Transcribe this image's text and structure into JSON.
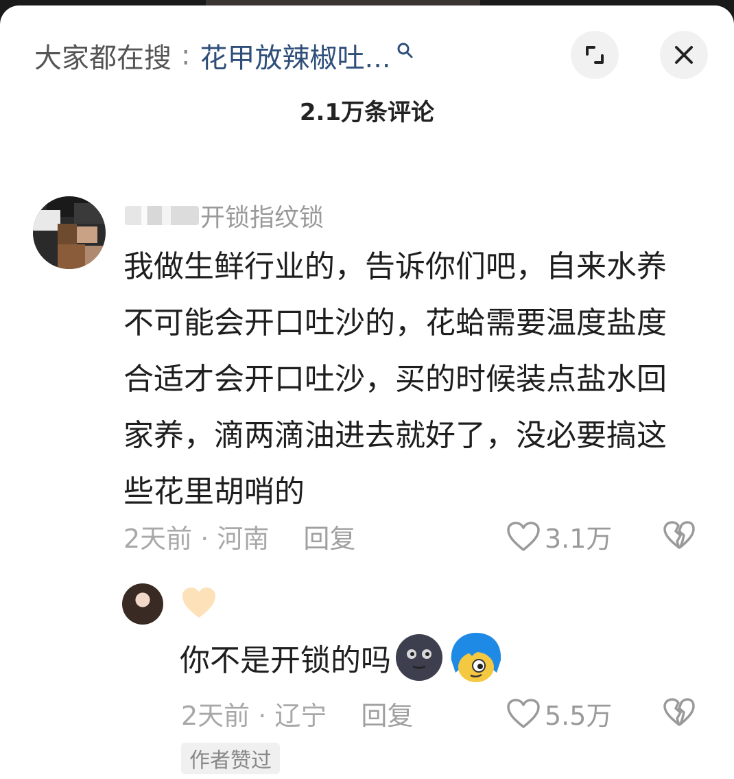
{
  "header": {
    "search_prefix": "大家都在搜",
    "search_colon": ":",
    "search_term": "花甲放辣椒吐...",
    "title": "2.1万条评论"
  },
  "comment": {
    "username": "开锁指纹锁",
    "text": "我做生鲜行业的，告诉你们吧，自来水养不可能会开口吐沙的，花蛤需要温度盐度合适才会开口吐沙，买的时候装点盐水回家养，滴两滴油进去就好了，没必要搞这些花里胡哨的",
    "time_location": "2天前 · 河南",
    "reply_label": "回复",
    "like_count": "3.1万"
  },
  "reply": {
    "text": "你不是开锁的吗",
    "time_location": "2天前 · 辽宁",
    "reply_label": "回复",
    "like_count": "5.5万",
    "author_badge": "作者赞过"
  },
  "icons": {
    "search": "search-icon",
    "expand": "expand-icon",
    "close": "close-icon",
    "like": "heart-outline-icon",
    "dislike": "broken-heart-icon",
    "reply_badge": "heart-badge-icon"
  },
  "colors": {
    "search_term": "#2f4f7a",
    "reply_heart": "#fde1b8",
    "meta_text": "#a8a8a8"
  }
}
